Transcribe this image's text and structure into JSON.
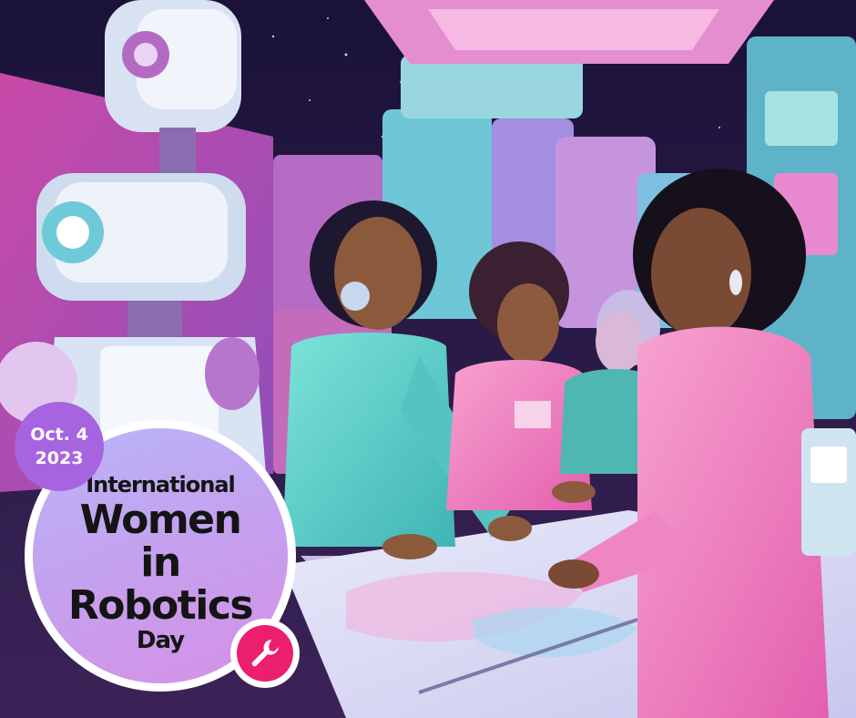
{
  "badge": {
    "date_line1": "Oct. 4",
    "date_line2": "2023",
    "accent_color": "#a764e0"
  },
  "title": {
    "line1": "International",
    "line2": "Women",
    "line3": "in",
    "line4": "Robotics",
    "line5": "Day"
  },
  "icons": {
    "tool": "wrench-icon",
    "tool_color": "#ec1e6e"
  }
}
